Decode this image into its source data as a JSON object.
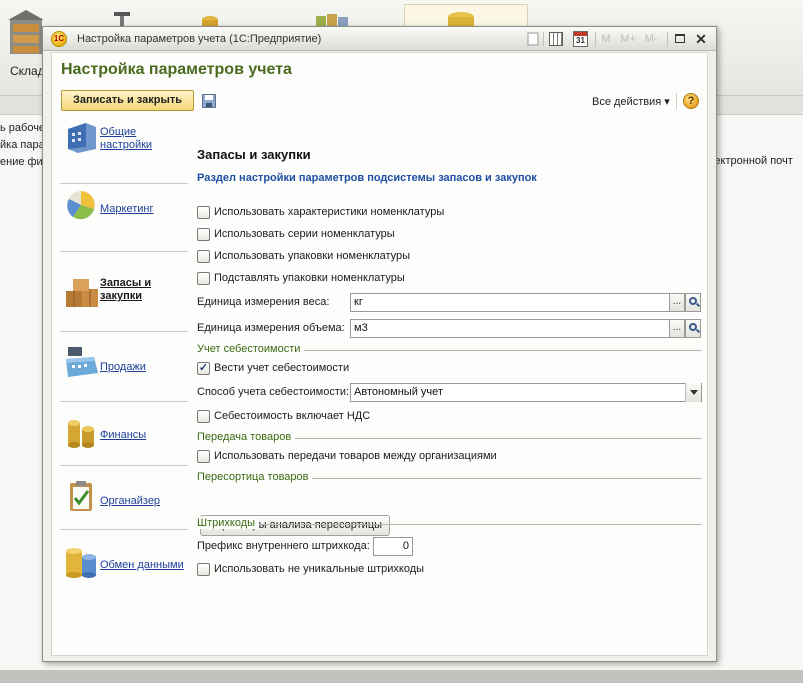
{
  "background": {
    "store_label": "Склад",
    "lines": [
      "ь рабоче",
      "йка пара",
      "ение фи"
    ],
    "email_fragment": "лектронной почт"
  },
  "window": {
    "title": "Настройка параметров учета  (1С:Предприятие)",
    "logo_text": "1С",
    "toolbar": {
      "calendar_day": "31",
      "m_label": "M",
      "m_plus_label": "M+",
      "m_minus_label": "M-"
    }
  },
  "form": {
    "title": "Настройка параметров учета",
    "save_close_label": "Записать и закрыть",
    "all_actions_label": "Все действия ▾",
    "help_label": "?"
  },
  "nav": {
    "items": [
      {
        "label": "Общие\nнастройки",
        "icon": "building-icon",
        "active": false
      },
      {
        "label": "Маркетинг",
        "icon": "pie-chart-icon",
        "active": false
      },
      {
        "label": "Запасы и\nзакупки",
        "icon": "boxes-icon",
        "active": true
      },
      {
        "label": "Продажи",
        "icon": "cash-register-icon",
        "active": false
      },
      {
        "label": "Финансы",
        "icon": "coins-icon",
        "active": false
      },
      {
        "label": "Органайзер",
        "icon": "clipboard-icon",
        "active": false
      },
      {
        "label": "Обмен данными",
        "icon": "database-icon",
        "active": false
      }
    ]
  },
  "section": {
    "title": "Запасы и закупки",
    "description": "Раздел настройки параметров подсистемы запасов и закупок",
    "options": [
      {
        "label": "Использовать характеристики номенклатуры",
        "checked": false
      },
      {
        "label": "Использовать серии номенклатуры",
        "checked": false
      },
      {
        "label": "Использовать упаковки номенклатуры",
        "checked": false
      },
      {
        "label": "Подставлять упаковки номенклатуры",
        "checked": false
      }
    ],
    "weight_unit": {
      "label": "Единица измерения веса:",
      "value": "кг"
    },
    "volume_unit": {
      "label": "Единица измерения объема:",
      "value": "м3"
    },
    "cost": {
      "group_label": "Учет себестоимости",
      "keep_cost": {
        "label": "Вести учет себестоимости",
        "checked": true
      },
      "method_label": "Способ учета себестоимости:",
      "method_value": "Автономный учет",
      "includes_vat": {
        "label": "Себестоимость включает НДС",
        "checked": false
      }
    },
    "transfer": {
      "group_label": "Передача товаров",
      "use_transfer": {
        "label": "Использовать передачи товаров между организациями",
        "checked": false
      }
    },
    "resort": {
      "group_label": "Пересортица товаров",
      "button_label": "Параметры анализа пересортицы"
    },
    "barcodes": {
      "group_label": "Штрихкоды",
      "prefix_label": "Префикс внутреннего штрихкода:",
      "prefix_value": "0",
      "non_unique": {
        "label": "Использовать не уникальные штрихкоды",
        "checked": false
      }
    }
  },
  "glyphs": {
    "check": "✓",
    "ellipsis": "...",
    "close": "✕"
  },
  "colors": {
    "form_title": "#4a6a1f",
    "group_label": "#3d6a14",
    "link": "#1d3f9a",
    "description": "#1e4fa3",
    "save_button": "#f1d577"
  }
}
